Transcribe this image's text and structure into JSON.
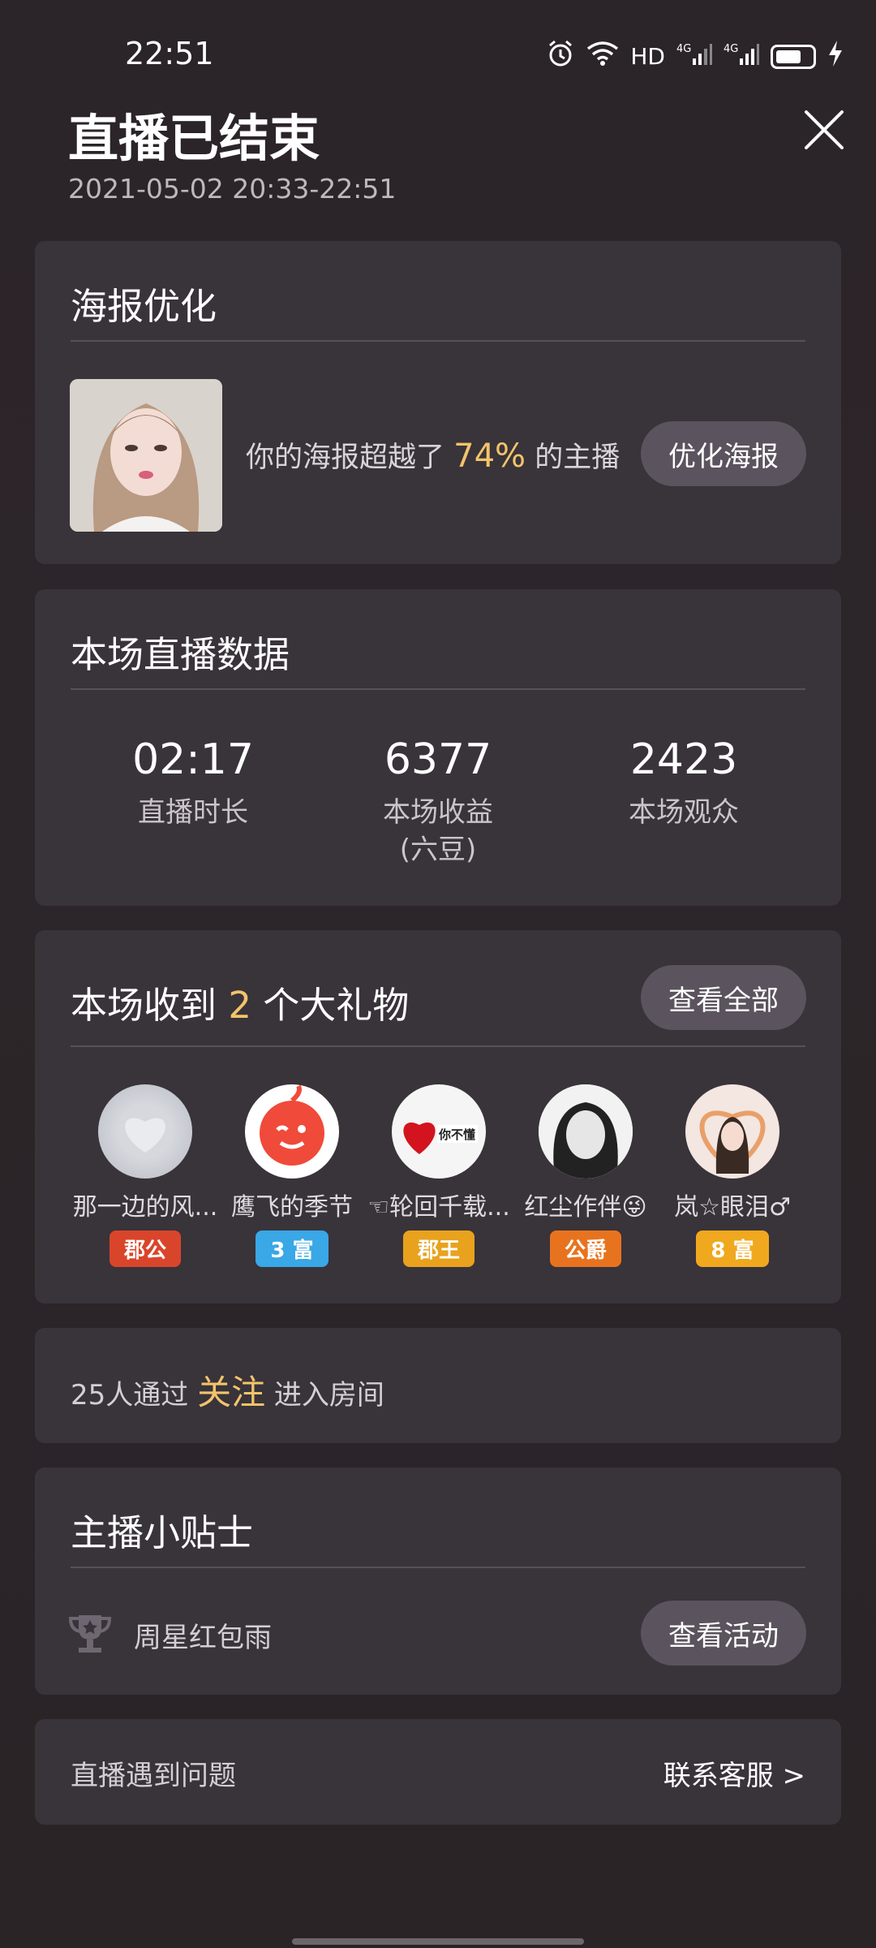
{
  "status_bar": {
    "time": "22:51",
    "network": "HD",
    "sig1": "4G",
    "sig2": "4G"
  },
  "header": {
    "title": "直播已结束",
    "datetime": "2021-05-02 20:33-22:51"
  },
  "poster": {
    "title": "海报优化",
    "text_prefix": "你的海报超越了",
    "percent": "74%",
    "text_suffix": "的主播",
    "button": "优化海报"
  },
  "stats": {
    "title": "本场直播数据",
    "items": [
      {
        "value": "02:17",
        "label": "直播时长",
        "sub": ""
      },
      {
        "value": "6377",
        "label": "本场收益",
        "sub": "(六豆)"
      },
      {
        "value": "2423",
        "label": "本场观众",
        "sub": ""
      }
    ]
  },
  "gifts": {
    "title_prefix": "本场收到",
    "count": "2",
    "title_suffix": "个大礼物",
    "button": "查看全部",
    "givers": [
      {
        "name": "那一边的风...",
        "badge": "郡公",
        "badge_color": "#d9452b"
      },
      {
        "name": "鹰飞的季节",
        "badge": "3 富",
        "badge_color": "#3aa7e6"
      },
      {
        "name": "☜轮回千载...",
        "badge": "郡王",
        "badge_color": "#e8a21e"
      },
      {
        "name": "红尘作伴😜",
        "badge": "公爵",
        "badge_color": "#e8731e"
      },
      {
        "name": "岚☆眼泪♂",
        "badge": "8 富",
        "badge_color": "#f0a81e"
      }
    ]
  },
  "follow": {
    "prefix": "25人通过",
    "highlight": "关注",
    "suffix": "进入房间"
  },
  "tips": {
    "title": "主播小贴士",
    "item": "周星红包雨",
    "button": "查看活动"
  },
  "problem": {
    "left": "直播遇到问题",
    "right": "联系客服 >"
  },
  "colors": {
    "accent": "#f2c46a",
    "card": "#39333a",
    "pill": "#5b535d"
  }
}
